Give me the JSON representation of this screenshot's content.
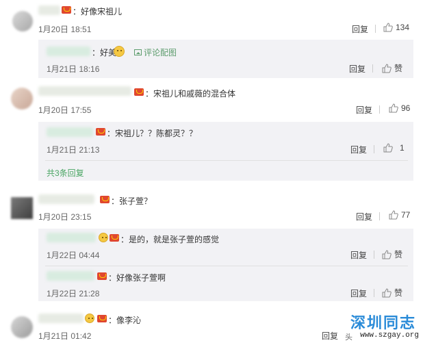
{
  "comments": [
    {
      "text": "：好像宋祖儿",
      "date": "1月20日 18:51",
      "reply_label": "回复",
      "like_count": "134",
      "replies": [
        {
          "text": "：好美",
          "date": "1月21日 18:16",
          "reply_label": "回复",
          "like_label": "赞",
          "link_label": "评论配图",
          "emoji": "cat-face"
        }
      ]
    },
    {
      "text": "：宋祖儿和戚薇的混合体",
      "date": "1月20日 17:55",
      "reply_label": "回复",
      "like_count": "96",
      "replies": [
        {
          "text": "：宋祖儿？？陈都灵？？",
          "date": "1月21日 21:13",
          "reply_label": "回复",
          "like_count": "1"
        }
      ],
      "total_replies_label": "共3条回复"
    },
    {
      "text": "：张子萱？",
      "date": "1月20日 23:15",
      "reply_label": "回复",
      "like_count": "77",
      "replies": [
        {
          "text": "：是的，就是张子萱的感觉",
          "date": "1月22日 04:44",
          "reply_label": "回复",
          "like_label": "赞"
        },
        {
          "text": "：好像张子萱啊",
          "date": "1月22日 21:28",
          "reply_label": "回复",
          "like_label": "赞"
        }
      ]
    },
    {
      "text": "：像李沁",
      "date": "1月21日 01:42",
      "reply_label": "回复"
    }
  ],
  "watermark": {
    "title": "深圳同志",
    "url": "www.szgay.org",
    "prefix": "头"
  },
  "colors": {
    "reply_box_bg": "#f2f2f5",
    "link_green": "#4aa563",
    "badge_red": "#e0472f",
    "watermark_blue": "#2a8bd8"
  },
  "icons": [
    "thumbs-up-icon",
    "member-badge-icon",
    "image-icon",
    "cat-emoji-icon"
  ]
}
